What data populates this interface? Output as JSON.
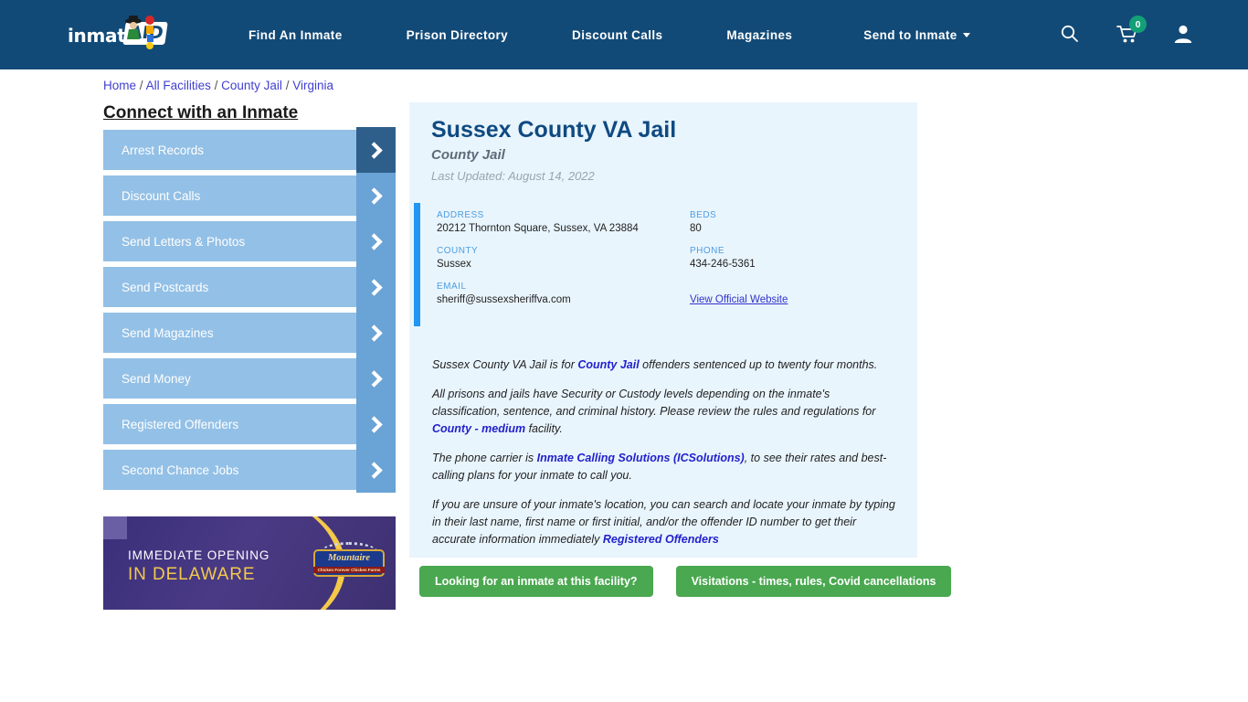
{
  "nav": {
    "logo_text": "inmate",
    "logo_accent": "AID",
    "links": [
      {
        "label": "Find An Inmate"
      },
      {
        "label": "Prison Directory"
      },
      {
        "label": "Discount Calls"
      },
      {
        "label": "Magazines"
      },
      {
        "label": "Send to Inmate"
      }
    ],
    "icons": {
      "search": "search-icon",
      "cart": "cart-icon",
      "cart_count": "0",
      "account": "user-icon"
    },
    "colors": {
      "bar": "#124a77",
      "badge": "#14a077"
    }
  },
  "breadcrumb": {
    "items": [
      "Home",
      "All Facilities",
      "County Jail",
      "Virginia"
    ],
    "separator": "/"
  },
  "sidebar": {
    "heading": "Connect with an Inmate",
    "items": [
      {
        "label": "Arrest Records"
      },
      {
        "label": "Discount Calls"
      },
      {
        "label": "Send Letters & Photos"
      },
      {
        "label": "Send Postcards"
      },
      {
        "label": "Send Magazines"
      },
      {
        "label": "Send Money"
      },
      {
        "label": "Registered Offenders"
      },
      {
        "label": "Second Chance Jobs"
      }
    ]
  },
  "ad": {
    "line1": "IMMEDIATE OPENING",
    "line2": "IN DELAWARE",
    "logo_name": "Mountaire",
    "logo_sub": "Chicken Forever Chicken Farms"
  },
  "facility": {
    "title": "Sussex County VA Jail",
    "type": "County Jail",
    "last_updated": "Last Updated: August 14, 2022",
    "fields": {
      "address_label": "ADDRESS",
      "address_value": "20212 Thornton Square, Sussex, VA 23884",
      "county_label": "COUNTY",
      "county_value": "Sussex",
      "email_label": "EMAIL",
      "email_value": "sheriff@sussexsheriffva.com",
      "beds_label": "BEDS",
      "beds_value": "80",
      "phone_label": "PHONE",
      "phone_value": "434-246-5361",
      "website_link": "View Official Website"
    },
    "paragraphs": {
      "p1_a": "Sussex County VA Jail is for ",
      "p1_link": "County Jail",
      "p1_b": " offenders sentenced up to twenty four months.",
      "p2_a": "All prisons and jails have Security or Custody levels depending on the inmate's classification, sentence, and criminal history. Please review the rules and regulations for ",
      "p2_link": "County - medium",
      "p2_b": " facility.",
      "p3_a": "The phone carrier is ",
      "p3_link": "Inmate Calling Solutions (ICSolutions)",
      "p3_b": ", to see their rates and best-calling plans for your inmate to call you.",
      "p4_a": "If you are unsure of your inmate's location, you can search and locate your inmate by typing in their last name, first name or first initial, and/or the offender ID number to get their accurate information immediately ",
      "p4_link": "Registered Offenders"
    }
  },
  "cta": {
    "primary": "Looking for an inmate at this facility?",
    "secondary": "Visitations - times, rules, Covid cancellations"
  }
}
